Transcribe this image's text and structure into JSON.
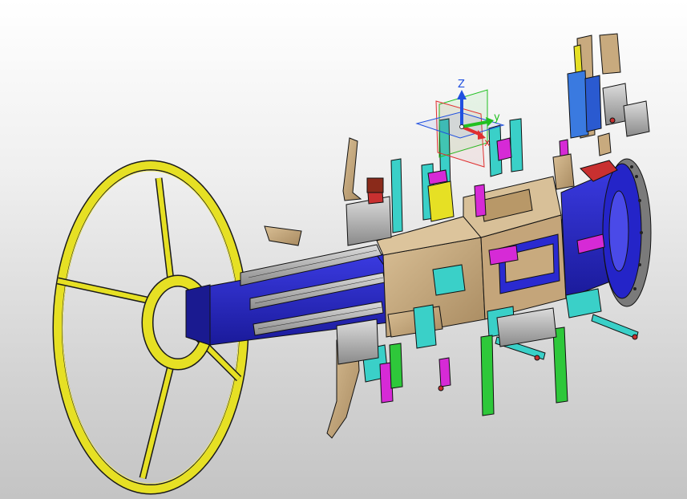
{
  "viewport": {
    "colors": {
      "background_top": "#ffffff",
      "background_bottom": "#c4c4c4",
      "handwheel": "#e6e024",
      "blue_body": "#2424c8",
      "tan_block": "#c8aa7e",
      "cyan_part": "#3ad0c8",
      "magenta_part": "#d62ad6",
      "green_part": "#2ec83a",
      "gray_metal": "#a6a6a6",
      "red_part": "#c83030"
    }
  },
  "compass": {
    "z_label": "Z",
    "x_label": "x",
    "y_label": "y",
    "x_color": "#e03030",
    "y_color": "#20c020",
    "z_color": "#2050e0"
  }
}
